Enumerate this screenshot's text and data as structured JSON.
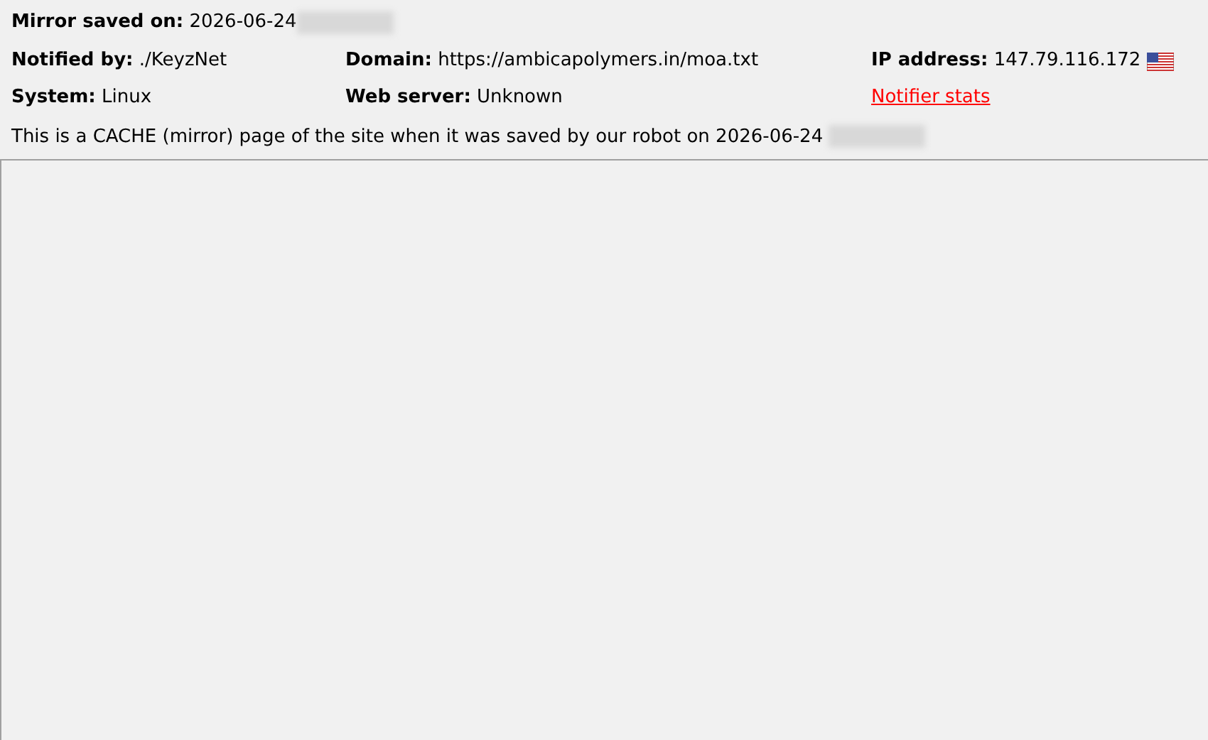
{
  "mirror_saved": {
    "label": "Mirror saved on:",
    "value": "2026-06-24"
  },
  "info_rows": [
    [
      {
        "label": "Notified by:",
        "value": "./KeyzNet"
      },
      {
        "label": "Domain:",
        "value": "https://ambicapolymers.in/moa.txt"
      },
      {
        "label": "IP address:",
        "value": "147.79.116.172",
        "flag": true
      }
    ],
    [
      {
        "label": "System:",
        "value": "Linux"
      },
      {
        "label": "Web server:",
        "value": "Unknown"
      },
      {
        "link": "Notifier stats"
      }
    ]
  ],
  "cache_notice": "This is a CACHE (mirror) page of the site when it was saved by our robot on 2026-06-24"
}
